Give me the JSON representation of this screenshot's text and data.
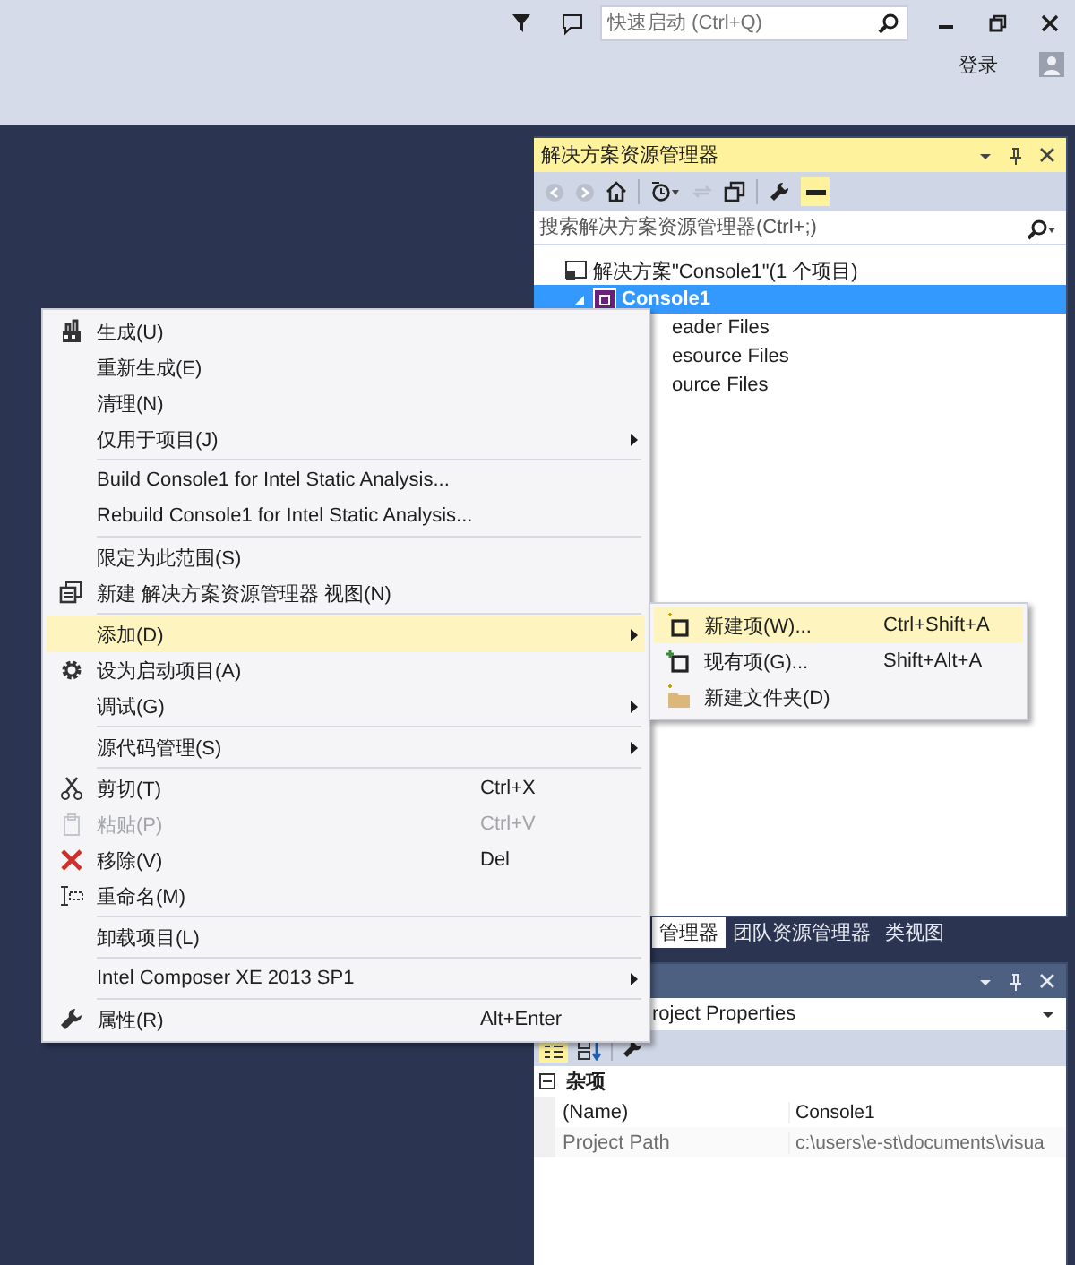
{
  "title_bar": {
    "search": {
      "placeholder": "快速启动 (Ctrl+Q)"
    },
    "sign_in": "登录"
  },
  "solution_explorer": {
    "title": "解决方案资源管理器",
    "search": {
      "placeholder": "搜索解决方案资源管理器(Ctrl+;)"
    },
    "tree": [
      {
        "label": "解决方案\"Console1\"(1 个项目)",
        "selected": false,
        "expanded": true,
        "children": [
          {
            "label": "Console1",
            "selected": true,
            "expanded": true,
            "children": [
              {
                "label": "eader Files",
                "selected": false
              },
              {
                "label": "esource Files",
                "selected": false
              },
              {
                "label": "ource Files",
                "selected": false
              }
            ]
          }
        ]
      }
    ]
  },
  "explorer_tabs": [
    {
      "label": "管理器",
      "selected": true
    },
    {
      "label": "团队资源管理器",
      "selected": false
    },
    {
      "label": "类视图",
      "selected": false
    }
  ],
  "properties": {
    "object": "roject Properties",
    "category": {
      "label": "杂项",
      "expanded": true
    },
    "rows": [
      {
        "name": "(Name)",
        "value": "Console1",
        "disabled": false
      },
      {
        "name": "Project Path",
        "value": "c:\\users\\e-st\\documents\\visua",
        "disabled": true
      }
    ]
  },
  "context_menu": {
    "groups": [
      [
        {
          "label": "生成(U)",
          "selected": false,
          "disabled": false,
          "submenu": false
        },
        {
          "label": "重新生成(E)",
          "selected": false,
          "disabled": false,
          "submenu": false
        },
        {
          "label": "清理(N)",
          "selected": false,
          "disabled": false,
          "submenu": false
        },
        {
          "label": "仅用于项目(J)",
          "selected": false,
          "disabled": false,
          "submenu": true
        }
      ],
      [
        {
          "label": "Build Console1 for Intel Static Analysis...",
          "selected": false,
          "disabled": false,
          "submenu": false
        },
        {
          "label": "Rebuild Console1 for Intel Static Analysis...",
          "selected": false,
          "disabled": false,
          "submenu": false
        }
      ],
      [
        {
          "label": "限定为此范围(S)",
          "selected": false,
          "disabled": false,
          "submenu": false
        },
        {
          "label": "新建 解决方案资源管理器 视图(N)",
          "selected": false,
          "disabled": false,
          "submenu": false
        }
      ],
      [
        {
          "label": "添加(D)",
          "selected": true,
          "disabled": false,
          "submenu": true
        },
        {
          "label": "设为启动项目(A)",
          "selected": false,
          "disabled": false,
          "submenu": false
        },
        {
          "label": "调试(G)",
          "selected": false,
          "disabled": false,
          "submenu": true
        }
      ],
      [
        {
          "label": "源代码管理(S)",
          "selected": false,
          "disabled": false,
          "submenu": true
        }
      ],
      [
        {
          "label": "剪切(T)",
          "shortcut": "Ctrl+X",
          "selected": false,
          "disabled": false,
          "submenu": false
        },
        {
          "label": "粘贴(P)",
          "shortcut": "Ctrl+V",
          "selected": false,
          "disabled": true,
          "submenu": false
        },
        {
          "label": "移除(V)",
          "shortcut": "Del",
          "selected": false,
          "disabled": false,
          "submenu": false
        },
        {
          "label": "重命名(M)",
          "selected": false,
          "disabled": false,
          "submenu": false
        }
      ],
      [
        {
          "label": "卸载项目(L)",
          "selected": false,
          "disabled": false,
          "submenu": false
        }
      ],
      [
        {
          "label": "Intel Composer XE 2013 SP1",
          "selected": false,
          "disabled": false,
          "submenu": true
        }
      ],
      [
        {
          "label": "属性(R)",
          "shortcut": "Alt+Enter",
          "selected": false,
          "disabled": false,
          "submenu": false
        }
      ]
    ]
  },
  "submenu": [
    {
      "label": "新建项(W)...",
      "shortcut": "Ctrl+Shift+A",
      "selected": true
    },
    {
      "label": "现有项(G)...",
      "shortcut": "Shift+Alt+A",
      "selected": false
    },
    {
      "label": "新建文件夹(D)",
      "selected": false
    }
  ]
}
